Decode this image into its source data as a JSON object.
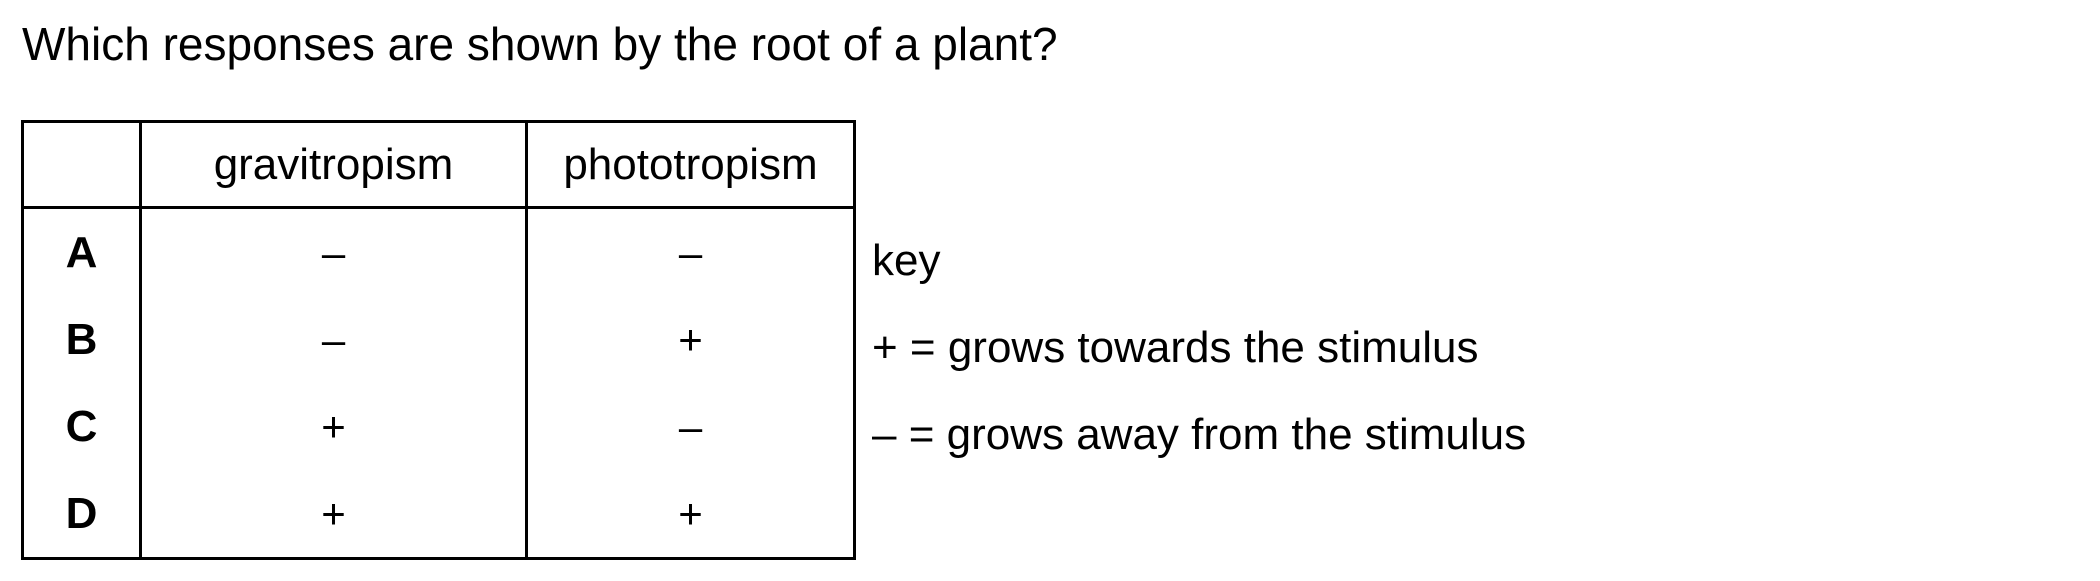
{
  "question": "Which responses are shown by the root of a plant?",
  "table": {
    "headers": [
      "",
      "gravitropism",
      "phototropism"
    ],
    "rows": [
      {
        "option": "A",
        "gravitropism": "–",
        "phototropism": "–"
      },
      {
        "option": "B",
        "gravitropism": "–",
        "phototropism": "+"
      },
      {
        "option": "C",
        "gravitropism": "+",
        "phototropism": "–"
      },
      {
        "option": "D",
        "gravitropism": "+",
        "phototropism": "+"
      }
    ]
  },
  "key": {
    "title": "key",
    "lines": [
      "+ = grows towards the stimulus",
      "– = grows away from the stimulus"
    ]
  }
}
